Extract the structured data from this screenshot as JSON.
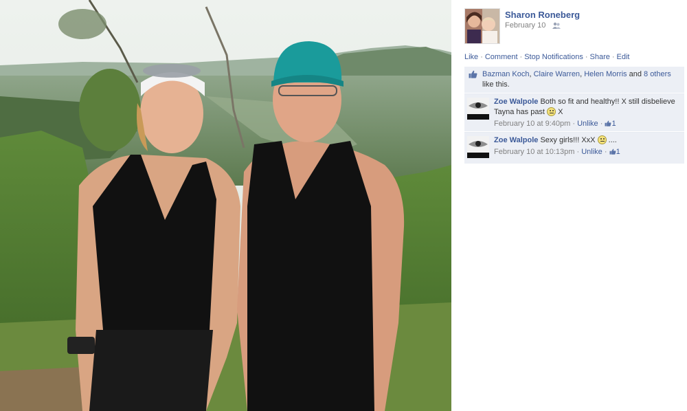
{
  "post": {
    "poster_name": "Sharon Roneberg",
    "date": "February 10",
    "audience_icon": "friends-icon"
  },
  "actions": {
    "like": "Like",
    "comment": "Comment",
    "stop_notifications": "Stop Notifications",
    "share": "Share",
    "edit": "Edit",
    "separator": "·"
  },
  "likes": {
    "icon": "thumbs-up-icon",
    "names": [
      "Bazman Koch",
      "Claire Warren",
      "Helen Morris"
    ],
    "sep1": ", ",
    "sep2": ", ",
    "and": " and ",
    "others": "8 others",
    "suffix": " like this."
  },
  "comments": [
    {
      "author": "Zoe Walpole",
      "text": "Both so fit and healthy!! X still disbelieve Tayna has past",
      "text_after": "X",
      "time": "February 10 at 9:40pm",
      "unlike": "Unlike",
      "like_count": "1"
    },
    {
      "author": "Zoe Walpole",
      "text": "Sexy girls!!! XxX",
      "text_after": "....",
      "time": "February 10 at 10:13pm",
      "unlike": "Unlike",
      "like_count": "1"
    }
  ],
  "colors": {
    "link": "#3b5998",
    "ufi_bg": "#eceff5",
    "meta": "#808080"
  }
}
